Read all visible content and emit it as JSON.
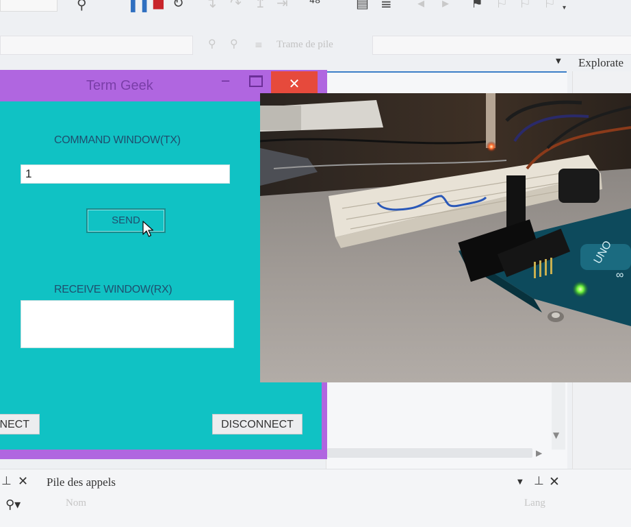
{
  "vs": {
    "toolbar_text": "Trame de pile",
    "explorer_label": "Explorate",
    "bottom_panel": {
      "title": "Pile des appels",
      "col_name": "Nom",
      "col_lang": "Lang"
    }
  },
  "app": {
    "title": "Term Geek",
    "close_glyph": "✕",
    "command_label": "COMMAND WINDOW(TX)",
    "command_value": "1",
    "send_label": "SEND",
    "receive_label": "RECEIVE WINDOW(RX)",
    "connect_label": "NECT",
    "disconnect_label": "DISCONNECT"
  },
  "colors": {
    "window_frame": "#b066e0",
    "client_bg": "#10c2c4",
    "close_button": "#e64a3c",
    "vs_bg": "#eef0f3",
    "vs_accent": "#3c7ec7"
  },
  "icons": {
    "toolbar": [
      "find-icon",
      "pause-icon",
      "stop-icon",
      "restart-icon",
      "step-icon",
      "breakpoints-icon",
      "bookmark-icon"
    ],
    "bottom": [
      "pin-icon",
      "close-icon",
      "search-icon",
      "dropdown-icon"
    ]
  }
}
